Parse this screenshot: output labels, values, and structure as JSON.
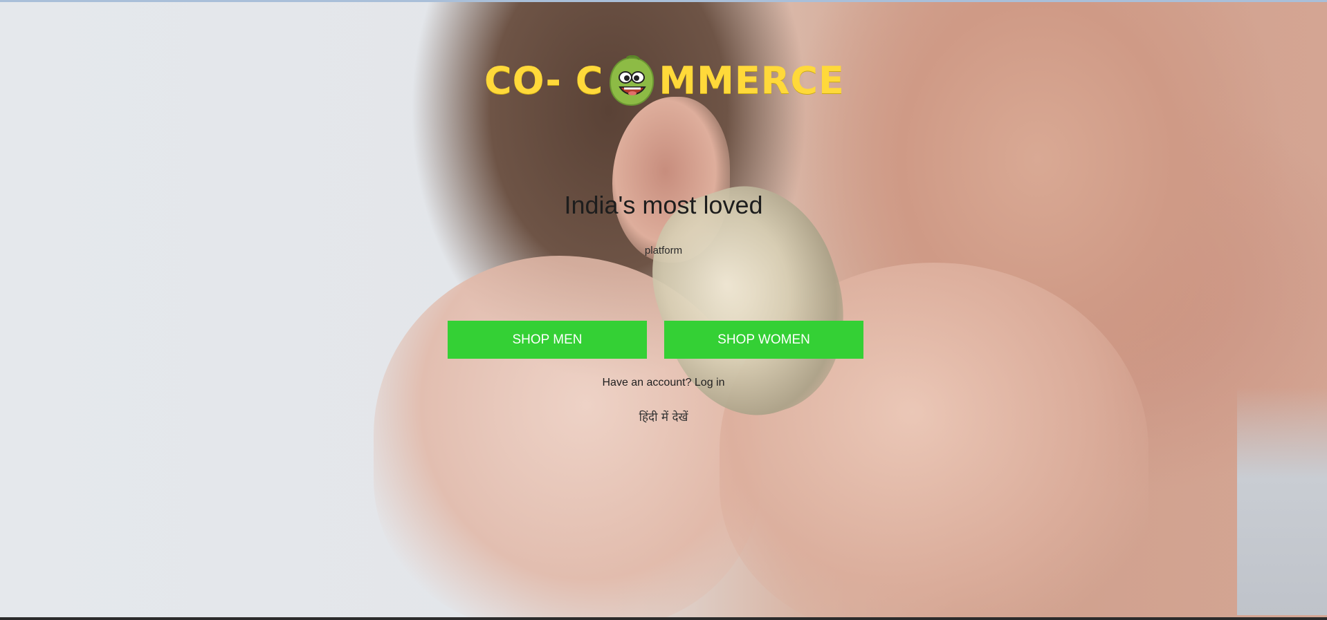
{
  "brand": {
    "logo_left": "CO- C",
    "logo_right": "MMERCE"
  },
  "hero": {
    "headline": "India's most loved",
    "subline": "platform"
  },
  "actions": {
    "shop_men": "SHOP MEN",
    "shop_women": "SHOP WOMEN"
  },
  "account": {
    "prompt": "Have an account? ",
    "login_link": "Log in"
  },
  "language": {
    "switch_label": "हिंदी में देखें"
  },
  "colors": {
    "logo": "#ffd93a",
    "button": "#34d035",
    "button_text": "#ffffff"
  }
}
